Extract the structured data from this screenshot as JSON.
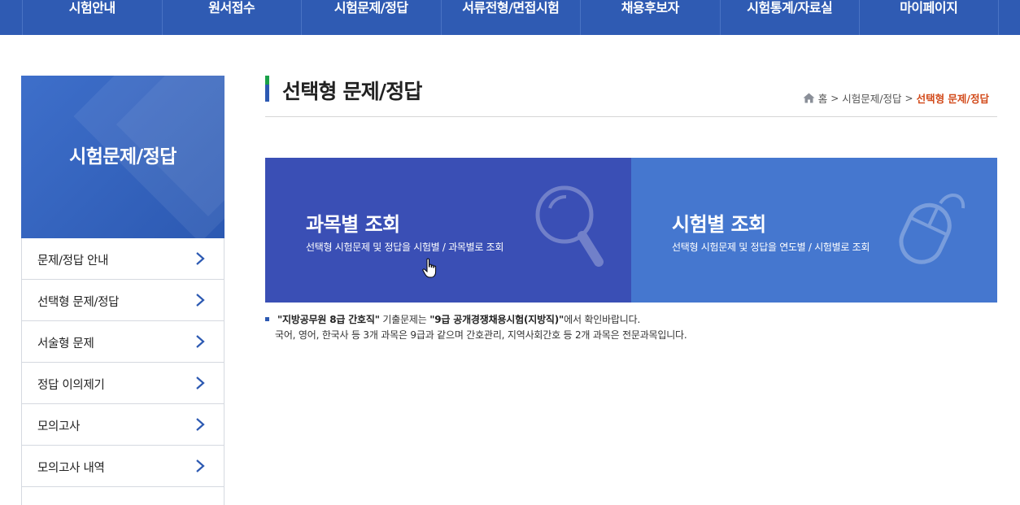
{
  "topnav": {
    "items": [
      {
        "label": "시험안내"
      },
      {
        "label": "원서접수"
      },
      {
        "label": "시험문제/정답"
      },
      {
        "label": "서류전형/면접시험"
      },
      {
        "label": "채용후보자"
      },
      {
        "label": "시험통계/자료실"
      },
      {
        "label": "마이페이지"
      }
    ]
  },
  "sidebar": {
    "title": "시험문제/정답",
    "items": [
      {
        "label": "문제/정답 안내"
      },
      {
        "label": "선택형 문제/정답"
      },
      {
        "label": "서술형 문제"
      },
      {
        "label": "정답 이의제기"
      },
      {
        "label": "모의고사"
      },
      {
        "label": "모의고사 내역"
      }
    ]
  },
  "page": {
    "title": "선택형 문제/정답",
    "breadcrumb": {
      "home": "홈",
      "level1": "시험문제/정답",
      "current": "선택형 문제/정답"
    }
  },
  "cards": [
    {
      "title": "과목별 조회",
      "desc": "선택형 시험문제 및 정답을 시험별 / 과목별로 조회",
      "icon": "magnifier-icon"
    },
    {
      "title": "시험별 조회",
      "desc": "선택형 시험문제 및 정답을 연도별 / 시험별로 조회",
      "icon": "mouse-icon"
    }
  ],
  "notice": {
    "q1": "\"지방공무원 8급 간호직\"",
    "t1": " 기출문제는 ",
    "q2": "\"9급 공개경쟁채용시험(지방직)\"",
    "t2": "에서 확인바랍니다.",
    "line2": "국어, 영어, 한국사 등 3개 과목은 9급과 같으며 간호관리, 지역사회간호 등 2개 과목은 전문과목입니다."
  },
  "colors": {
    "nav_bg": "#2f5bb3",
    "card1_bg": "#3a4fb5",
    "card2_bg": "#4577cf",
    "accent_current": "#d24a1a",
    "title_bar_green": "#1aa14a"
  }
}
